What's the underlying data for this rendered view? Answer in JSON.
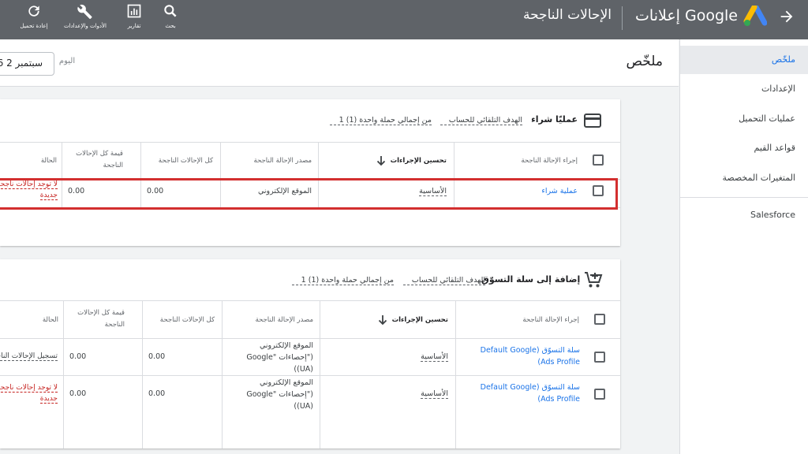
{
  "topbar": {
    "title": "الإحالات الناجحة",
    "brand": "إعلانات Google",
    "tools": [
      {
        "label": "إعادة تحميل",
        "icon": "refresh-icon"
      },
      {
        "label": "الأدوات والإعدادات",
        "icon": "wrench-icon"
      },
      {
        "label": "تقارير",
        "icon": "reports-icon"
      },
      {
        "label": "بحث",
        "icon": "search-icon"
      }
    ]
  },
  "sidebar": {
    "items": [
      "ملخّص",
      "الإعدادات",
      "عمليات التحميل",
      "قواعد القيم",
      "المتغيرات المخصصة",
      "Salesforce"
    ]
  },
  "header": {
    "title": "ملخّص",
    "date_label": "اليوم",
    "date_value": "26 سبتمبر 2"
  },
  "table_headers": {
    "action": "إجراء الإحالة الناجحة",
    "optimization": "تحسين الإجراءات",
    "source": "مصدر الإحالة الناجحة",
    "all_conv": "كل الإحالات الناجحة",
    "all_value": "قيمة كل الإحالات الناجحة",
    "status": "الحالة"
  },
  "card1": {
    "title": "عمليّا شراء",
    "goal": "الهدف التلقائي للحساب",
    "count": "1 من إجمالي حملة واحدة (1)",
    "rows": [
      {
        "action": "عملية شراء",
        "optimization": "الأساسية",
        "source": "الموقع الإلكتروني",
        "all_conv": "0.00",
        "all_value": "0.00",
        "status": "لا توجد إحالات ناجحة جديدة"
      }
    ]
  },
  "card2": {
    "title": "إضافة إلى سلة التسوّق",
    "goal": "الهدف التلقائي للحساب",
    "count": "1 من إجمالي حملة واحدة (1)",
    "rows": [
      {
        "action": "سلة التسوّق Default Google) (Ads Profile",
        "optimization": "الأساسية",
        "source": "الموقع الإلكتروني (\"إحصاءات Google\" (UA))",
        "all_conv": "0.00",
        "all_value": "0.00",
        "status": "تسجيل الإحالات الناجحة"
      },
      {
        "action": "سلة التسوّق Default Google) (Ads Profile",
        "optimization": "الأساسية",
        "source": "الموقع الإلكتروني (\"إحصاءات Google\" (UA))",
        "all_conv": "0.00",
        "all_value": "0.00",
        "status": "لا توجد إحالات ناجحة جديدة"
      }
    ]
  },
  "colors": {
    "topbar": "#5f6368",
    "link": "#1a73e8",
    "highlight": "#d32f2f",
    "warning": "#c5221f"
  }
}
